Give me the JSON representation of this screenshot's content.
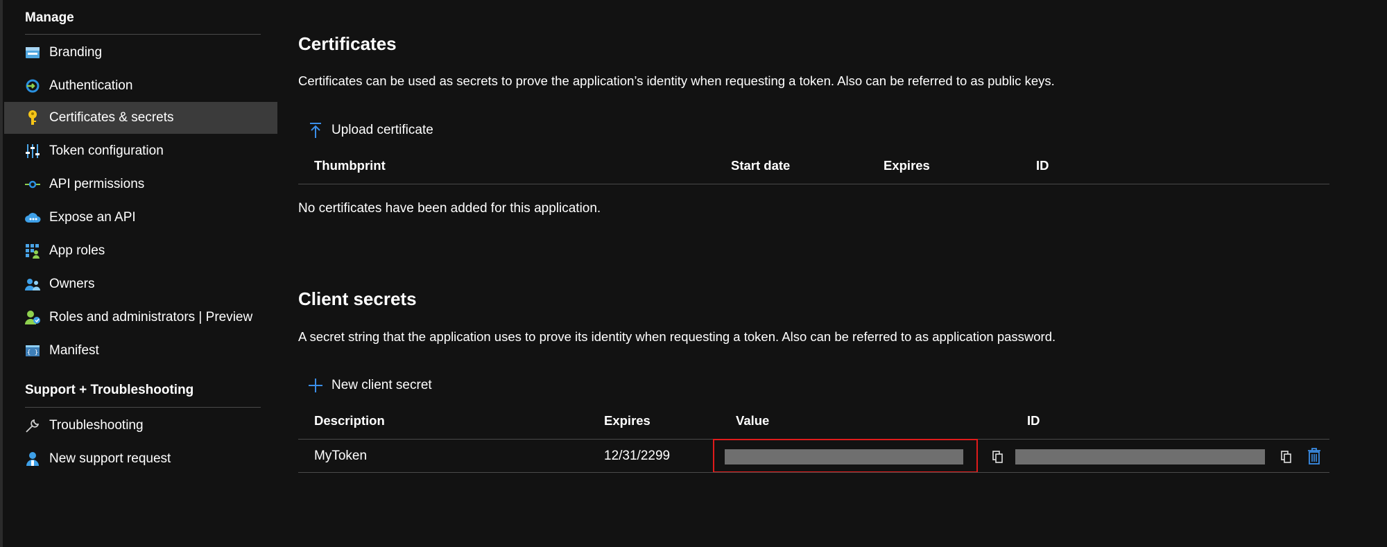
{
  "sidebar": {
    "manage_title": "Manage",
    "support_title": "Support + Troubleshooting",
    "items": [
      {
        "label": "Branding",
        "icon": "branding-icon"
      },
      {
        "label": "Authentication",
        "icon": "authentication-icon"
      },
      {
        "label": "Certificates & secrets",
        "icon": "key-icon",
        "active": true
      },
      {
        "label": "Token configuration",
        "icon": "token-config-icon"
      },
      {
        "label": "API permissions",
        "icon": "api-permissions-icon"
      },
      {
        "label": "Expose an API",
        "icon": "cloud-icon"
      },
      {
        "label": "App roles",
        "icon": "app-roles-icon"
      },
      {
        "label": "Owners",
        "icon": "owners-icon"
      },
      {
        "label": "Roles and administrators | Preview",
        "icon": "roles-admin-icon"
      },
      {
        "label": "Manifest",
        "icon": "manifest-icon"
      }
    ],
    "support_items": [
      {
        "label": "Troubleshooting",
        "icon": "wrench-icon"
      },
      {
        "label": "New support request",
        "icon": "support-person-icon"
      }
    ]
  },
  "certificates": {
    "title": "Certificates",
    "description": "Certificates can be used as secrets to prove the application’s identity when requesting a token. Also can be referred to as public keys.",
    "upload_label": "Upload certificate",
    "columns": [
      "Thumbprint",
      "Start date",
      "Expires",
      "ID"
    ],
    "empty_message": "No certificates have been added for this application."
  },
  "secrets": {
    "title": "Client secrets",
    "description": "A secret string that the application uses to prove its identity when requesting a token. Also can be referred to as application password.",
    "new_label": "New client secret",
    "columns": [
      "Description",
      "Expires",
      "Value",
      "ID"
    ],
    "rows": [
      {
        "description": "MyToken",
        "expires": "12/31/2299"
      }
    ]
  },
  "colors": {
    "accent": "#0078d4",
    "highlight": "#e01b1b",
    "active_bg": "#3b3b3b"
  }
}
